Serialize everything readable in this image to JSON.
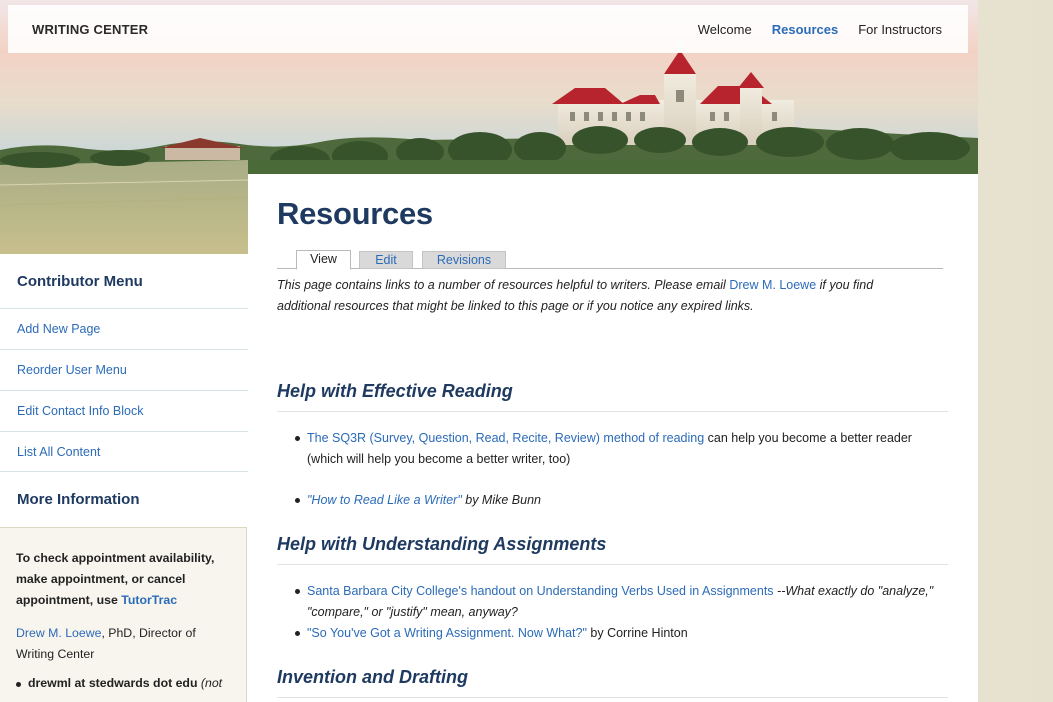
{
  "header": {
    "site_title": "WRITING CENTER",
    "nav": [
      "Welcome",
      "Resources",
      "For Instructors"
    ],
    "active_nav": "Resources"
  },
  "sidebar": {
    "contributor_heading": "Contributor Menu",
    "contributor_items": [
      "Add New Page",
      "Reorder User Menu",
      "Edit Contact Info Block",
      "List All Content"
    ],
    "more_info_heading": "More Information",
    "info": {
      "appointment_text": "To check appointment availability, make appointment, or cancel appointment, use",
      "tutortrac_link": "TutorTrac",
      "director_link": "Drew M. Loewe",
      "director_suffix": ", PhD, Director of Writing Center",
      "email_bold": "drewml at stedwards dot edu",
      "email_note": "(not"
    }
  },
  "main": {
    "title": "Resources",
    "tabs": [
      "View",
      "Edit",
      "Revisions"
    ],
    "active_tab": "View",
    "intro_before": "This page contains links to a number of resources helpful to writers. Please email",
    "intro_link": "Drew M. Loewe",
    "intro_after": "if you find additional resources that might be linked to this page or if you notice any expired links.",
    "sections": [
      {
        "heading": "Help with Effective Reading",
        "items": [
          {
            "link": "The SQ3R (Survey, Question, Read, Recite, Review) method of reading",
            "text": "can help you become a better reader (which will help you become a better writer, too)"
          },
          {
            "link": "\"How to Read Like a Writer\"",
            "text": "by Mike Bunn"
          }
        ]
      },
      {
        "heading": "Help with Understanding Assignments",
        "items": [
          {
            "link": "Santa Barbara City College's handout on Understanding Verbs Used in Assignments",
            "text": "--What exactly do \"analyze,\" \"compare,\" or \"justify\" mean, anyway?"
          },
          {
            "link": "\"So You've Got a Writing Assignment. Now What?\"",
            "text": "by Corrine Hinton"
          }
        ]
      },
      {
        "heading": "Invention and Drafting",
        "items": []
      }
    ]
  },
  "colors": {
    "link": "#2b6bb8",
    "heading": "#1f3a60",
    "roof": "#b8242e",
    "page_bg": "#ece8d8"
  }
}
